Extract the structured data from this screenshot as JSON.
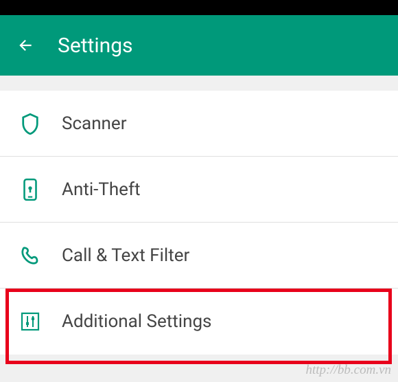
{
  "header": {
    "title": "Settings"
  },
  "items": [
    {
      "icon": "shield-icon",
      "label": "Scanner"
    },
    {
      "icon": "phone-lock-icon",
      "label": "Anti-Theft"
    },
    {
      "icon": "phone-call-icon",
      "label": "Call & Text Filter"
    },
    {
      "icon": "sliders-icon",
      "label": "Additional Settings"
    }
  ],
  "colors": {
    "accent": "#00997a",
    "highlight": "#e8001b"
  },
  "watermark": "http://bb.com.vn",
  "highlighted_index": 3
}
